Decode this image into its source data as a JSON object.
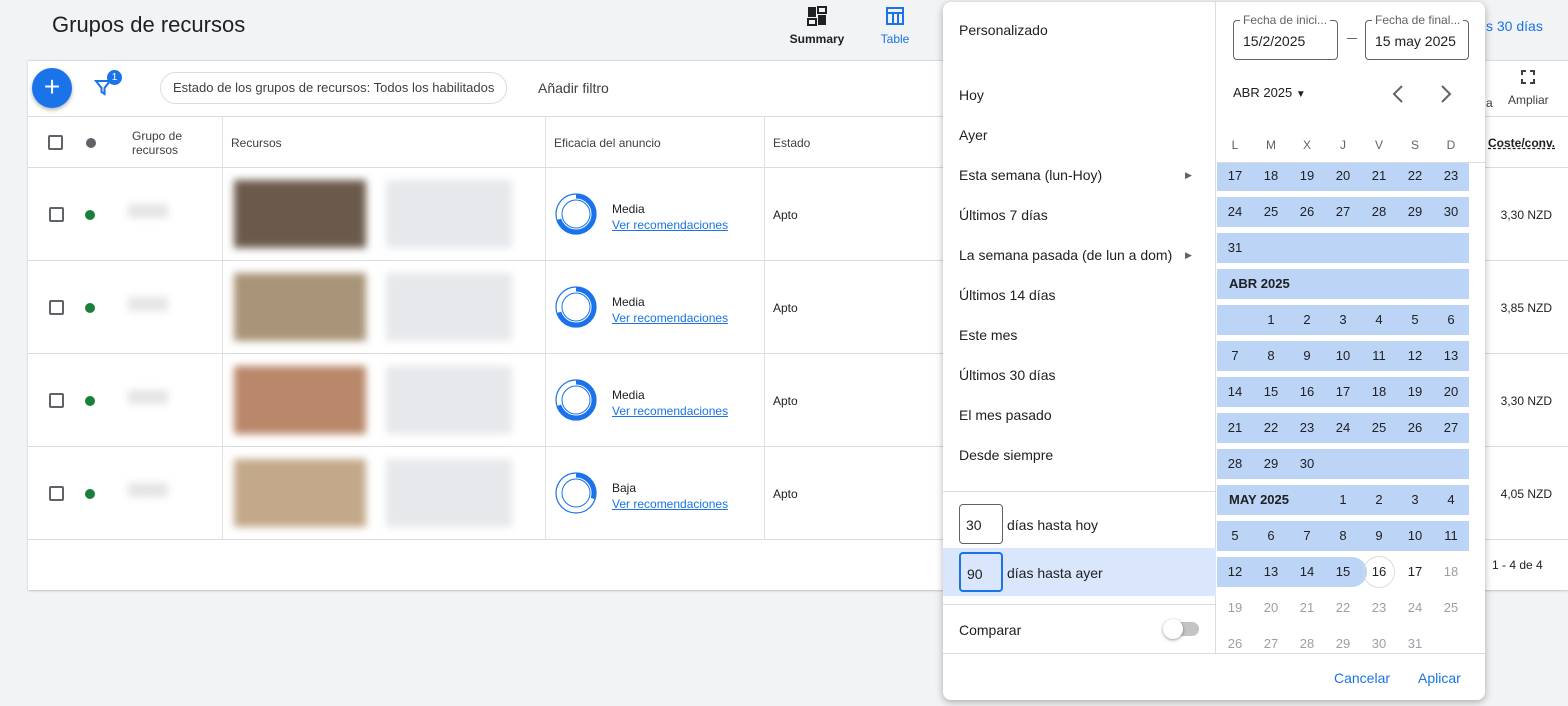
{
  "header": {
    "title": "Grupos de recursos",
    "views": [
      {
        "label": "Summary",
        "active": false
      },
      {
        "label": "Table",
        "active": true
      }
    ],
    "date_range_partial": "s 30 días"
  },
  "toolbar": {
    "filter_count": "1",
    "filter_chip": "Estado de los grupos de recursos: Todos los habilitados",
    "add_filter": "Añadir filtro",
    "expand_label": "Ampliar",
    "partial_label": "a"
  },
  "table": {
    "columns": [
      "Grupo de recursos",
      "Recursos",
      "Eficacia del anuncio",
      "Estado",
      "Coste/conv."
    ],
    "rows": [
      {
        "strength": "Media",
        "link": "Ver recomendaciones",
        "status": "Apto",
        "cost": "3,30 NZD",
        "fill": 0.7
      },
      {
        "strength": "Media",
        "link": "Ver recomendaciones",
        "status": "Apto",
        "cost": "3,85 NZD",
        "fill": 0.7
      },
      {
        "strength": "Media",
        "link": "Ver recomendaciones",
        "status": "Apto",
        "cost": "3,30 NZD",
        "fill": 0.7
      },
      {
        "strength": "Baja",
        "link": "Ver recomendaciones",
        "status": "Apto",
        "cost": "4,05 NZD",
        "fill": 0.3
      }
    ],
    "pagination": "1 - 4 de 4"
  },
  "picker": {
    "presets": [
      "Personalizado",
      "Hoy",
      "Ayer",
      "Esta semana (lun-Hoy)",
      "Últimos 7 días",
      "La semana pasada (de lun a dom)",
      "Últimos 14 días",
      "Este mes",
      "Últimos 30 días",
      "El mes pasado",
      "Desde siempre"
    ],
    "days_to_today": {
      "value": "30",
      "label": "días hasta hoy"
    },
    "days_to_yesterday": {
      "value": "90",
      "label": "días hasta ayer"
    },
    "compare_label": "Comparar",
    "compare_on": false,
    "start_label": "Fecha de inici...",
    "start_value": "15/2/2025",
    "end_label": "Fecha de final...",
    "end_value": "15 may 2025",
    "month_label": "ABR 2025",
    "weekdays": [
      "L",
      "M",
      "X",
      "J",
      "V",
      "S",
      "D"
    ],
    "rows": [
      {
        "days": [
          17,
          18,
          19,
          20,
          21,
          22,
          23
        ],
        "sel": 7
      },
      {
        "days": [
          24,
          25,
          26,
          27,
          28,
          29,
          30
        ],
        "sel": 7
      },
      {
        "days": [
          31,
          null,
          null,
          null,
          null,
          null,
          null
        ],
        "sel": 7
      },
      {
        "label": "ABR 2025",
        "days": [],
        "sel": 7
      },
      {
        "days": [
          null,
          1,
          2,
          3,
          4,
          5,
          6
        ],
        "sel": 7
      },
      {
        "days": [
          7,
          8,
          9,
          10,
          11,
          12,
          13
        ],
        "sel": 7
      },
      {
        "days": [
          14,
          15,
          16,
          17,
          18,
          19,
          20
        ],
        "sel": 7
      },
      {
        "days": [
          21,
          22,
          23,
          24,
          25,
          26,
          27
        ],
        "sel": 7
      },
      {
        "days": [
          28,
          29,
          30,
          null,
          null,
          null,
          null
        ],
        "sel": 7
      },
      {
        "label": "MAY 2025",
        "days": [
          null,
          null,
          null,
          1,
          2,
          3,
          4
        ],
        "sel": 7
      },
      {
        "days": [
          5,
          6,
          7,
          8,
          9,
          10,
          11
        ],
        "sel": 7
      },
      {
        "days": [
          12,
          13,
          14,
          15,
          16,
          17,
          18
        ],
        "sel": 4,
        "today": 4,
        "disabled_from": 6
      },
      {
        "days": [
          19,
          20,
          21,
          22,
          23,
          24,
          25
        ],
        "sel": 0,
        "disabled_from": 0
      },
      {
        "days": [
          26,
          27,
          28,
          29,
          30,
          31,
          null
        ],
        "sel": 0,
        "disabled_from": 0
      }
    ],
    "cancel": "Cancelar",
    "apply": "Aplicar"
  },
  "colors": {
    "accent": "#1a73e8",
    "range": "#bcd4f6",
    "active_dot": "#188038"
  }
}
